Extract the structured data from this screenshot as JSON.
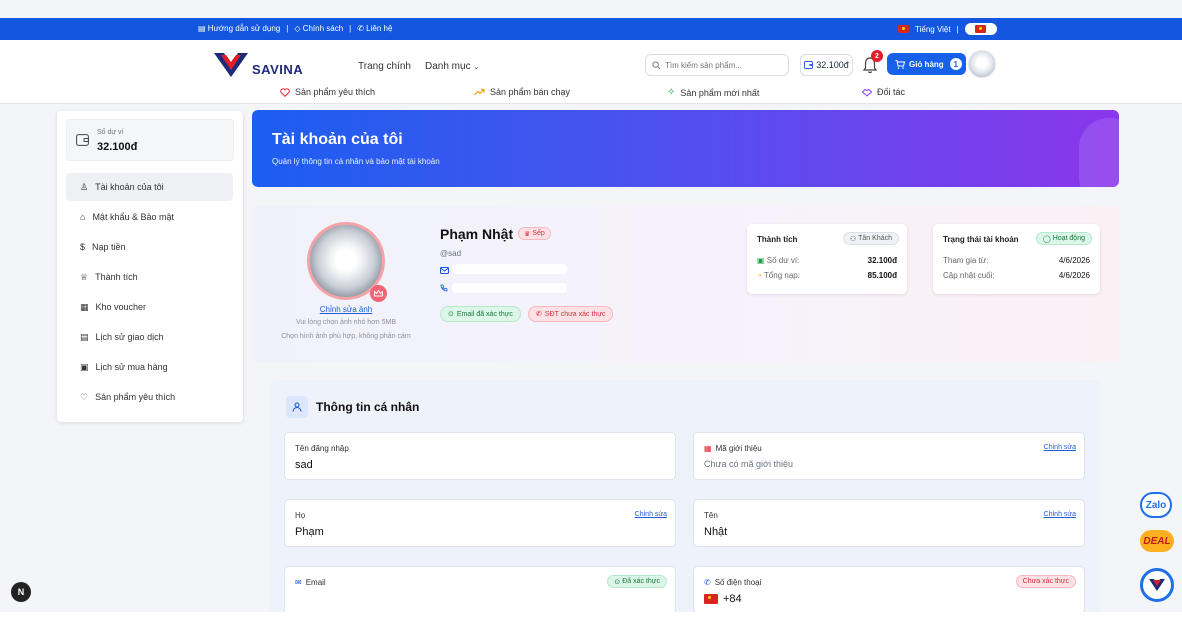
{
  "topbar": {
    "links": [
      "Hướng dẫn sử dụng",
      "Chính sách",
      "Liên hệ"
    ],
    "language": "Tiếng Việt"
  },
  "header": {
    "logo_text": "SAVINA",
    "nav": [
      "Trang chính",
      "Danh mục"
    ],
    "search_placeholder": "Tìm kiếm sản phẩm...",
    "balance": "32.100đ",
    "notification_count": "2",
    "cart_label": "Giỏ hàng",
    "cart_count": "1"
  },
  "subnav": [
    "Sản phẩm yêu thích",
    "Sản phẩm bán chạy",
    "Sản phẩm mới nhất",
    "Đối tác"
  ],
  "sidebar": {
    "wallet_label": "Số dư ví",
    "wallet_value": "32.100đ",
    "items": [
      "Tài khoản của tôi",
      "Mật khẩu & Bảo mật",
      "Nạp tiền",
      "Thành tích",
      "Kho voucher",
      "Lịch sử giao dịch",
      "Lịch sử mua hàng",
      "Sản phẩm yêu thích"
    ]
  },
  "banner": {
    "title": "Tài khoản của tôi",
    "subtitle": "Quản lý thông tin cá nhân và bảo mật tài khoản"
  },
  "profile": {
    "edit_photo": "Chỉnh sửa ảnh",
    "hint_1": "Vui lòng chọn ảnh nhỏ hơn 5MB",
    "hint_2": "Chọn hình ảnh phù hợp, không phản cảm",
    "name": "Phạm Nhật",
    "role": "Sếp",
    "handle": "@sad",
    "email_verified": "Email đã xác thực",
    "phone_unverified": "SĐT chưa xác thực"
  },
  "achievement_card": {
    "title": "Thành tích",
    "rank": "Tân Khách",
    "wallet_label": "Số dư ví:",
    "wallet_value": "32.100đ",
    "topup_label": "Tổng nạp:",
    "topup_value": "85.100đ"
  },
  "status_card": {
    "title": "Trạng thái tài khoản",
    "status": "Hoạt động",
    "joined_label": "Tham gia từ:",
    "joined_value": "4/6/2026",
    "updated_label": "Cập nhật cuối:",
    "updated_value": "4/6/2026"
  },
  "personal_info": {
    "title": "Thông tin cá nhân",
    "username_label": "Tên đăng nhập",
    "username_value": "sad",
    "referral_label": "Mã giới thiệu",
    "referral_value": "Chưa có mã giới thiệu",
    "edit": "Chỉnh sửa",
    "last_name_label": "Họ",
    "last_name_value": "Phạm",
    "first_name_label": "Tên",
    "first_name_value": "Nhật",
    "email_label": "Email",
    "email_badge": "Đã xác thực",
    "phone_label": "Số điện thoại",
    "phone_badge": "Chưa xác thực",
    "phone_prefix": "+84"
  },
  "floating": {
    "zalo": "Zalo",
    "deal": "DEAL",
    "n_badge": "N"
  },
  "colors": {
    "primary": "#1556e0",
    "banner_start": "#1b5ef0",
    "banner_end": "#8a36ec",
    "danger": "#e11d2a",
    "success": "#157a3d"
  }
}
